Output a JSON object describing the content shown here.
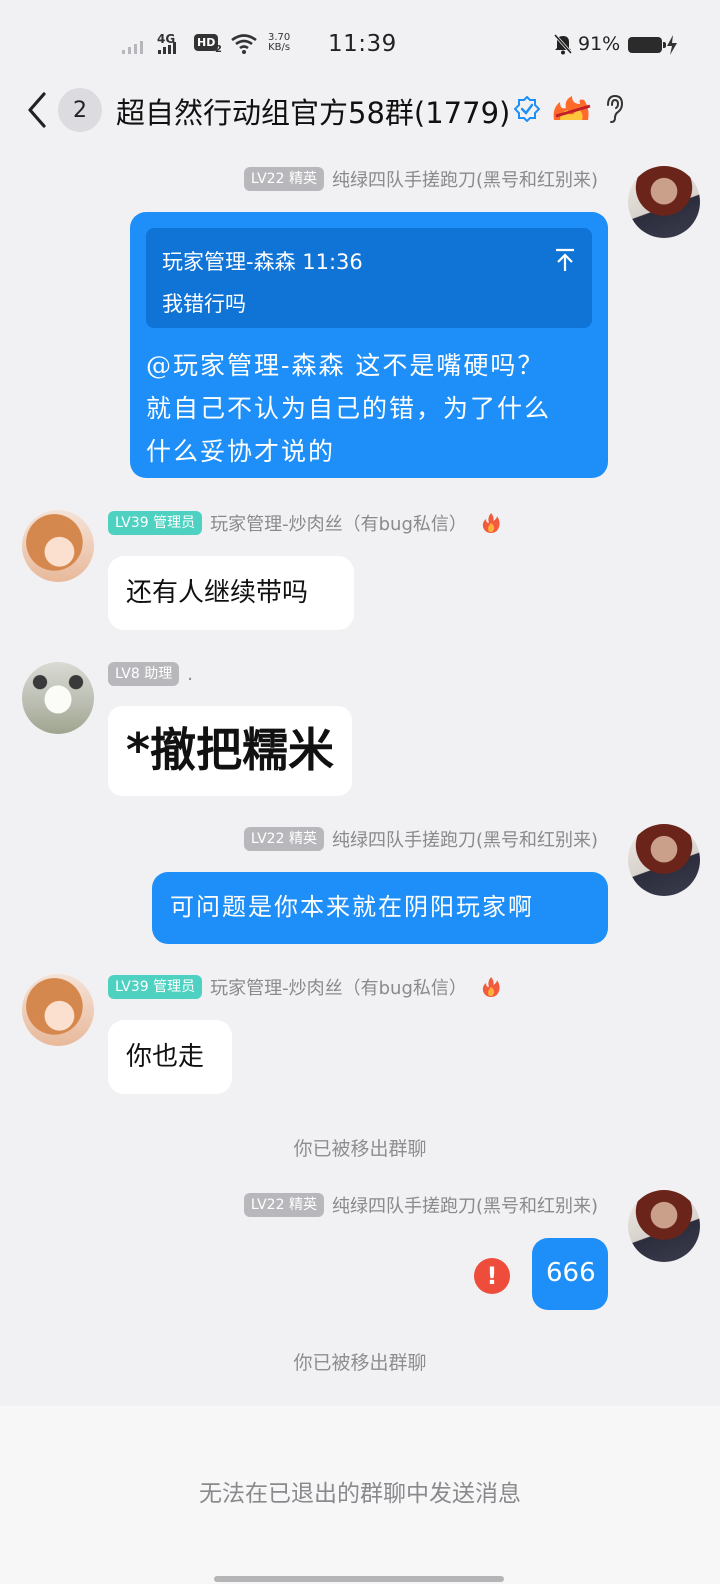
{
  "status_bar": {
    "network": "4G",
    "hd": "HD",
    "hd_sub": "2",
    "speed_value": "3.70",
    "speed_unit": "KB/s",
    "time": "11:39",
    "battery": "91%"
  },
  "header": {
    "unread_count": "2",
    "title": "超自然行动组官方58群(1779)"
  },
  "messages": {
    "m1": {
      "tag": "LV22 精英",
      "sender": "纯绿四队手搓跑刀(黑号和红别来)",
      "quote_head": "玩家管理-森森 11:36",
      "quote_body": "我错行吗",
      "line1": "@玩家管理-森森 这不是嘴硬吗？",
      "line2": "就自己不认为自己的错，为了什么",
      "line3": "什么妥协才说的"
    },
    "m2": {
      "tag": "LV39 管理员",
      "sender": "玩家管理-炒肉丝（有bug私信）",
      "text": "还有人继续带吗"
    },
    "m3": {
      "tag": "LV8 助理",
      "sender": ".",
      "sticker_text": "*撤把糯米"
    },
    "m4": {
      "tag": "LV22 精英",
      "sender": "纯绿四队手搓跑刀(黑号和红别来)",
      "text": "可问题是你本来就在阴阳玩家啊"
    },
    "m5": {
      "tag": "LV39 管理员",
      "sender": "玩家管理-炒肉丝（有bug私信）",
      "text": "你也走"
    },
    "m6": {
      "tag": "LV22 精英",
      "sender": "纯绿四队手搓跑刀(黑号和红别来)",
      "text": "666"
    }
  },
  "system": {
    "removed1": "你已被移出群聊",
    "removed2": "你已被移出群聊",
    "error_mark": "!"
  },
  "footer": {
    "text": "无法在已退出的群聊中发送消息"
  },
  "colors": {
    "bubble_blue": "#1e8ff8",
    "tag_teal": "#4fd1c2",
    "tag_gray": "#b8b8bc",
    "error_red": "#ee4d3c"
  }
}
